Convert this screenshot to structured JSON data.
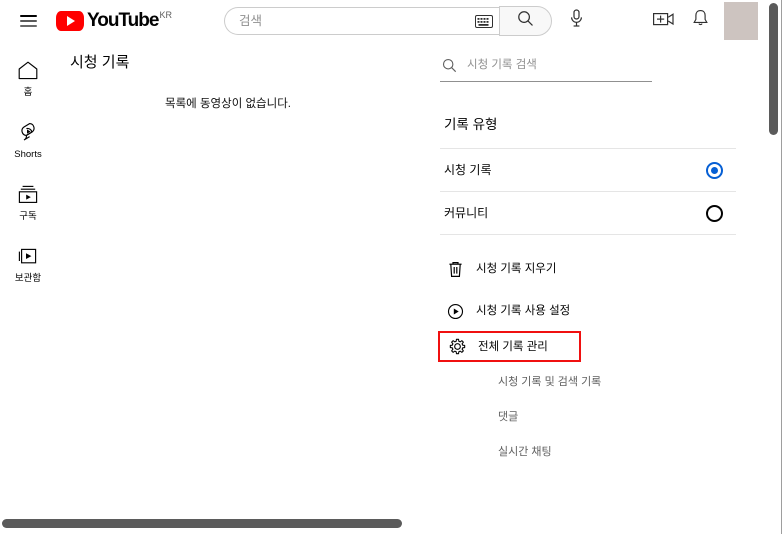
{
  "masthead": {
    "guide_label": "guide-menu",
    "logo_text": "YouTube",
    "logo_country": "KR",
    "search": {
      "placeholder": "검색",
      "value": "",
      "keyboard_icon": "keyboard-icon",
      "submit_icon": "search-icon"
    },
    "mic_icon": "microphone-icon",
    "create_icon": "create-video-icon",
    "notifications_icon": "bell-icon",
    "avatar_color": "#cdc4c0"
  },
  "mini_guide": {
    "items": [
      {
        "label": "홈",
        "icon": "home-icon"
      },
      {
        "label": "Shorts",
        "icon": "shorts-icon"
      },
      {
        "label": "구독",
        "icon": "subscriptions-icon"
      },
      {
        "label": "보관함",
        "icon": "library-icon"
      }
    ]
  },
  "main": {
    "title": "시청 기록",
    "empty_message": "목록에 동영상이 없습니다."
  },
  "right_panel": {
    "search": {
      "placeholder": "시청 기록 검색",
      "value": "",
      "icon": "search-icon"
    },
    "section_title": "기록 유형",
    "radio_options": [
      {
        "label": "시청 기록",
        "selected": true
      },
      {
        "label": "커뮤니티",
        "selected": false
      }
    ],
    "actions": [
      {
        "label": "시청 기록 지우기",
        "icon": "trash-icon",
        "highlighted": false
      },
      {
        "label": "시청 기록 사용 설정",
        "icon": "play-circle-icon",
        "highlighted": false
      },
      {
        "label": "전체 기록 관리",
        "icon": "gear-icon",
        "highlighted": true
      }
    ],
    "sub_links": [
      {
        "label": "시청 기록 및 검색 기록"
      },
      {
        "label": "댓글"
      },
      {
        "label": "실시간 채팅"
      }
    ]
  },
  "colors": {
    "accent_blue": "#065fd4",
    "brand_red": "#ff0000",
    "highlight_red": "#f01010",
    "scrollbar": "#5b5b5b"
  }
}
